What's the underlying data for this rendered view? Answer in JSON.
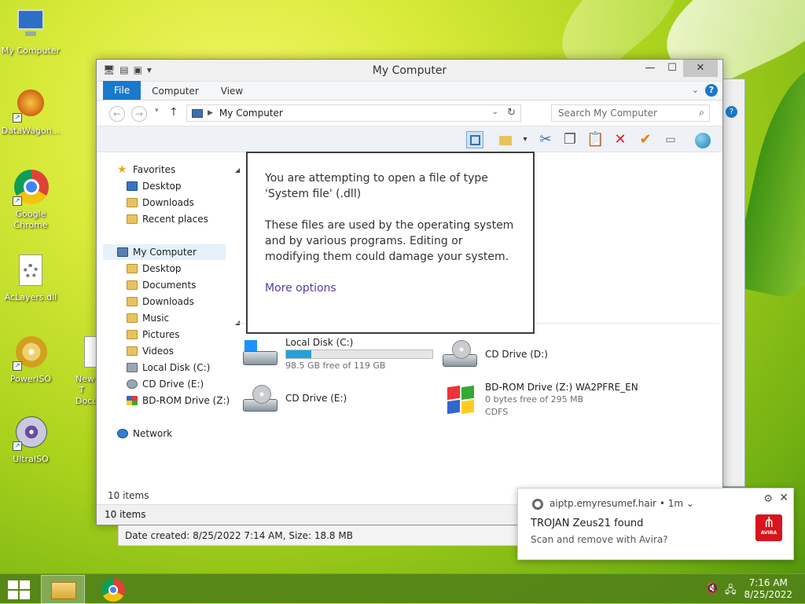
{
  "desktop": {
    "icons": [
      {
        "label": "My Computer"
      },
      {
        "label": "DataWagon..."
      },
      {
        "label": "Google Chrome"
      },
      {
        "label": "AcLayers.dll"
      },
      {
        "label": "PowerISO"
      },
      {
        "label": "New T Docu"
      },
      {
        "label": "UltraISO"
      }
    ]
  },
  "window": {
    "title": "My Computer",
    "ribbon_tabs": [
      "File",
      "Computer",
      "View"
    ],
    "address_path": "My Computer",
    "search_placeholder": "Search My Computer"
  },
  "nav_pane": {
    "favorites_label": "Favorites",
    "favorites": [
      "Desktop",
      "Downloads",
      "Recent places"
    ],
    "computer_label": "My Computer",
    "computer_items": [
      "Desktop",
      "Documents",
      "Downloads",
      "Music",
      "Pictures",
      "Videos",
      "Local Disk (C:)",
      "CD Drive (E:)",
      "BD-ROM Drive (Z:) W"
    ],
    "network_label": "Network"
  },
  "drives": {
    "local_c": {
      "name": "Local Disk (C:)",
      "free": "98.5 GB free of 119 GB",
      "used_fraction": 0.17
    },
    "cd_d": {
      "name": "CD Drive (D:)"
    },
    "cd_e": {
      "name": "CD Drive (E:)"
    },
    "bd_z": {
      "name": "BD-ROM Drive (Z:) WA2PFRE_EN",
      "free": "0 bytes free of 295 MB",
      "fs": "CDFS"
    }
  },
  "tooltip": {
    "line1": "You are attempting to open a file of type 'System file' (.dll)",
    "line2": "These files are used by the operating system and by various programs. Editing or modifying them could damage your system.",
    "link": "More options"
  },
  "status": {
    "items_top": "10 items",
    "items_bottom": "10 items",
    "details": "Date created: 8/25/2022 7:14 AM, Size: 18.8 MB"
  },
  "notification": {
    "source": "aiptp.emyresumef.hair",
    "age": "1m",
    "title": "TROJAN Zeus21 found",
    "body": "Scan and remove with Avira?",
    "brand_word": "AVIRA"
  },
  "taskbar": {
    "time": "7:16 AM",
    "date": "8/25/2022"
  },
  "colors": {
    "accent": "#1979ca",
    "disk_bar": "#26a0da",
    "avira_red": "#d8141c",
    "link_purple": "#5b3aa3"
  }
}
